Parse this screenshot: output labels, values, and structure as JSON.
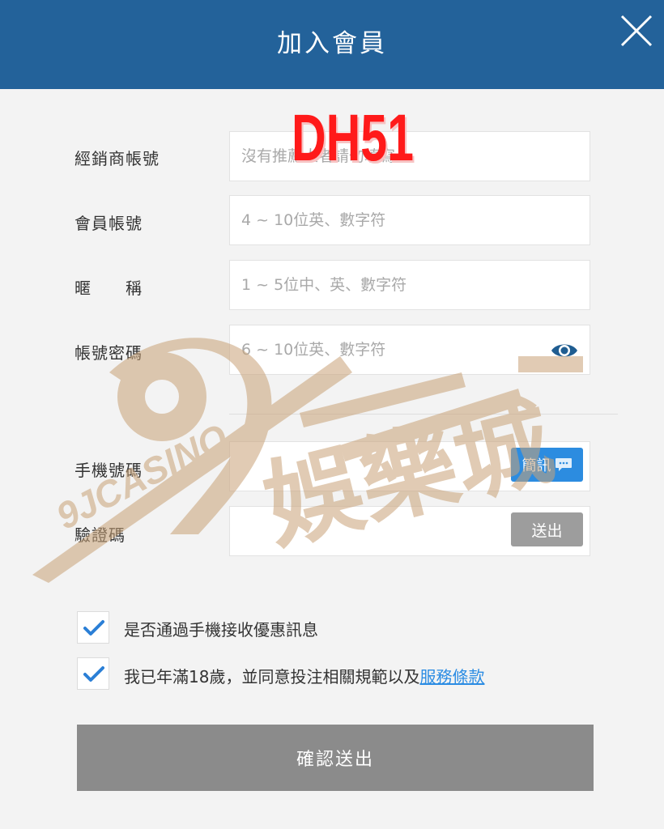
{
  "header": {
    "title": "加入會員",
    "close_icon": "close-icon"
  },
  "promo_code": "DH51",
  "form": {
    "dealer_label": "經銷商帳號",
    "dealer_placeholder": "沒有推薦人者請勿填寫",
    "account_label": "會員帳號",
    "account_placeholder": "4 ~ 10位英、數字符",
    "nickname_label": "暱　　稱",
    "nickname_placeholder": "1 ~ 5位中、英、數字符",
    "password_label": "帳號密碼",
    "password_placeholder": "6 ~ 10位英、數字符",
    "password_toggle_icon": "eye-icon",
    "phone_label": "手機號碼",
    "sms_button": "簡訊",
    "code_label": "驗證碼",
    "send_code_button": "送出"
  },
  "checks": {
    "promo_label": "是否通過手機接收優惠訊息",
    "promo_checked": true,
    "agree_label": "我已年滿18歲，並同意投注相關規範以及",
    "terms_link": "服務條款",
    "agree_checked": true
  },
  "submit": {
    "label": "確認送出"
  },
  "watermark": {
    "logo_text": "9JCASINO",
    "logo_chars": "娛樂城"
  },
  "colors": {
    "header": "#23629a",
    "accent": "#2c8ce0",
    "promo": "#ff1a1a",
    "watermark": "#c9a277"
  }
}
